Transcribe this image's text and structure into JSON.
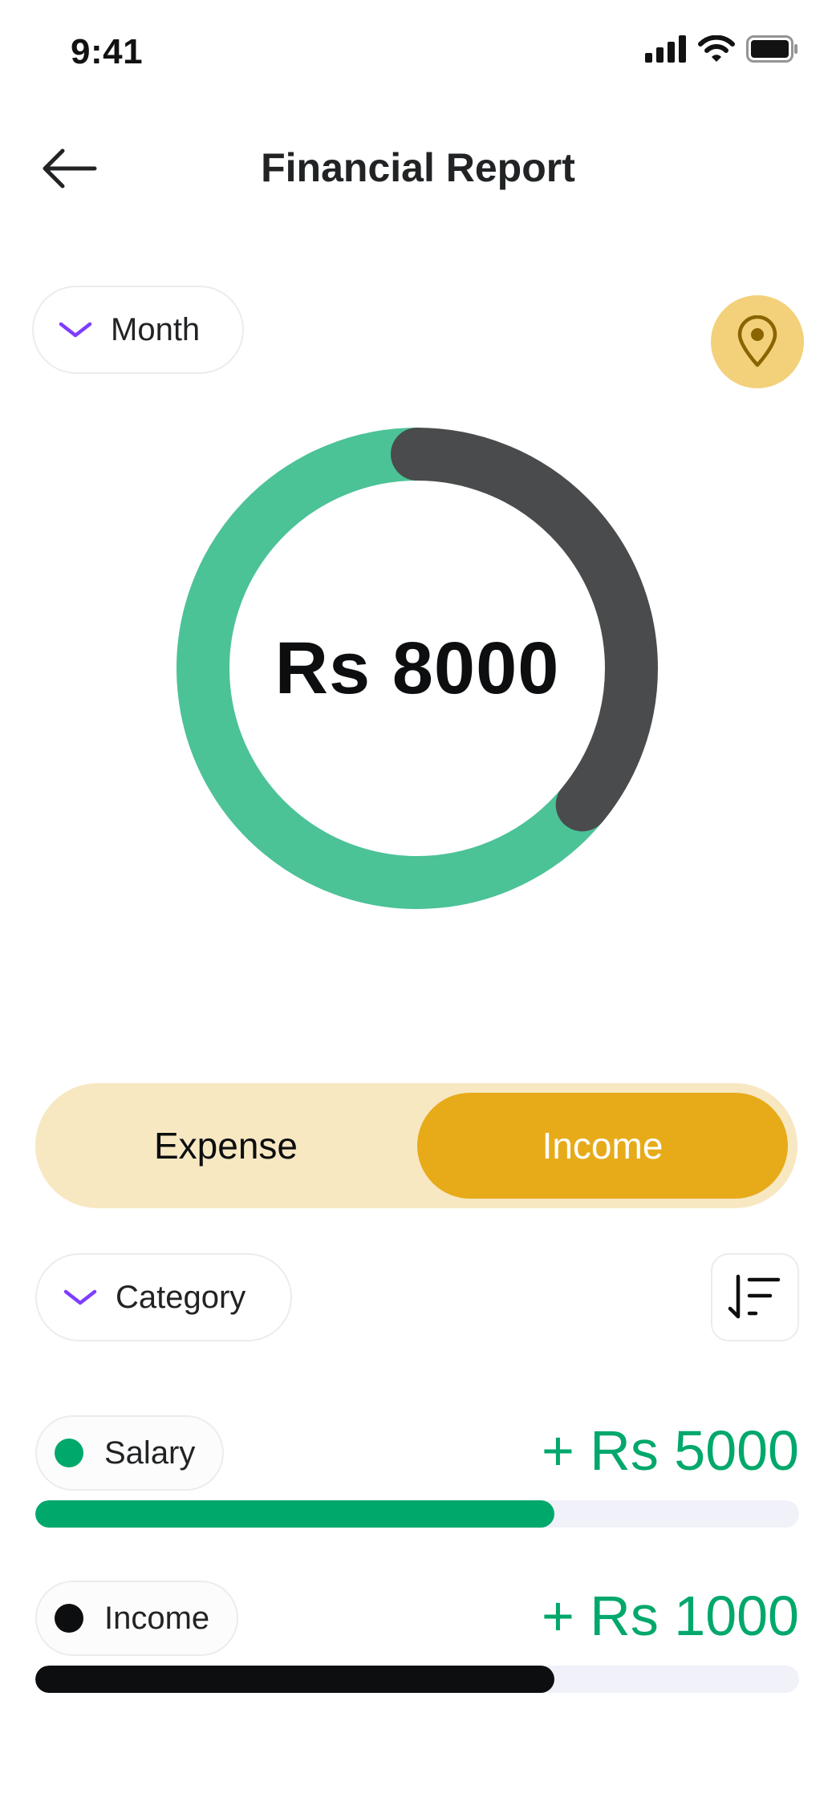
{
  "status_bar": {
    "time": "9:41"
  },
  "header": {
    "title": "Financial Report"
  },
  "filters": {
    "period_label": "Month",
    "category_label": "Category"
  },
  "summary": {
    "total": "Rs 8000",
    "ring": {
      "income_fraction": 0.64,
      "expense_fraction": 0.36,
      "income_color": "#00a86b",
      "expense_color": "#4a4b4c"
    }
  },
  "toggle": {
    "expense_label": "Expense",
    "income_label": "Income",
    "selected": "Income"
  },
  "items": [
    {
      "label": "Salary",
      "amount": "+ Rs 5000",
      "color": "#00a86b",
      "progress": 0.68
    },
    {
      "label": "Income",
      "amount": "+ Rs 1000",
      "color": "#0d0e0f",
      "progress": 0.68
    }
  ],
  "colors": {
    "accent_purple": "#7f3dff",
    "accent_yellow": "#e7ab1a",
    "income_green": "#00a86b"
  },
  "icons": [
    "arrow-left-icon",
    "chevron-down-icon",
    "location-pin-icon",
    "sort-icon",
    "signal-icon",
    "wifi-icon",
    "battery-icon"
  ]
}
